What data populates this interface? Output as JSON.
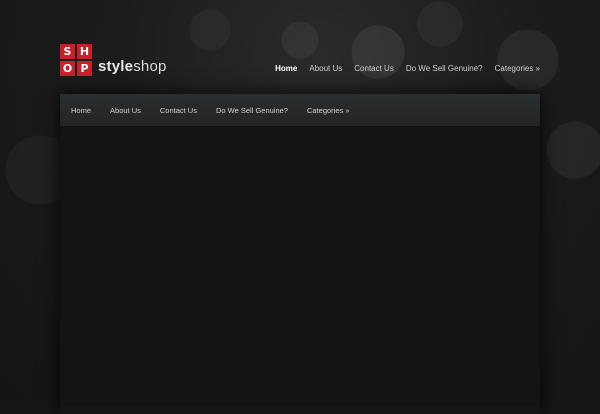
{
  "brand": {
    "logo_letters": [
      "S",
      "H",
      "O",
      "P"
    ],
    "name_strong": "style",
    "name_light": "shop",
    "accent_color": "#c8202a"
  },
  "top_nav": {
    "items": [
      {
        "label": "Home",
        "active": true
      },
      {
        "label": "About Us",
        "active": false
      },
      {
        "label": "Contact Us",
        "active": false
      },
      {
        "label": "Do We Sell Genuine?",
        "active": false
      },
      {
        "label": "Categories »",
        "active": false
      }
    ]
  },
  "main_nav": {
    "items": [
      {
        "label": "Home"
      },
      {
        "label": "About Us"
      },
      {
        "label": "Contact Us"
      },
      {
        "label": "Do We Sell Genuine?"
      },
      {
        "label": "Categories »"
      }
    ]
  }
}
